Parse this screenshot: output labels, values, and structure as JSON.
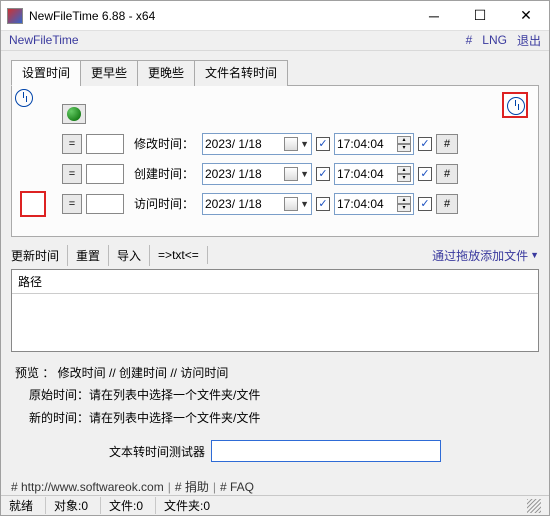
{
  "window": {
    "title": "NewFileTime 6.88 - x64"
  },
  "menubar": {
    "app": "NewFileTime",
    "hash": "#",
    "lng": "LNG",
    "exit": "退出"
  },
  "tabs": [
    "设置时间",
    "更早些",
    "更晚些",
    "文件名转时间"
  ],
  "rows": {
    "eq": "=",
    "modify": {
      "label": "修改时间：",
      "date": "2023/ 1/18",
      "time": "17:04:04"
    },
    "create": {
      "label": "创建时间：",
      "date": "2023/ 1/18",
      "time": "17:04:04"
    },
    "access": {
      "label": "访问时间：",
      "date": "2023/ 1/18",
      "time": "17:04:04"
    },
    "hash": "#"
  },
  "toolbar2": {
    "update": "更新时间",
    "reset": "重置",
    "import": "导入",
    "txt": "=>txt<=",
    "addfiles": "通过拖放添加文件"
  },
  "list": {
    "header": "路径"
  },
  "preview": {
    "line1": "预览 ： 修改时间   //   创建时间   //   访问时间",
    "line2": "原始时间：请在列表中选择一个文件夹/文件",
    "line3": "新的时间：请在列表中选择一个文件夹/文件"
  },
  "tester": {
    "label": "文本转时间测试器"
  },
  "footer": {
    "site": "# http://www.softwareok.com",
    "donate": "# 捐助",
    "faq": "# FAQ"
  },
  "status": {
    "ready": "就绪",
    "objects": "对象:0",
    "files": "文件:0",
    "folders": "文件夹:0"
  }
}
